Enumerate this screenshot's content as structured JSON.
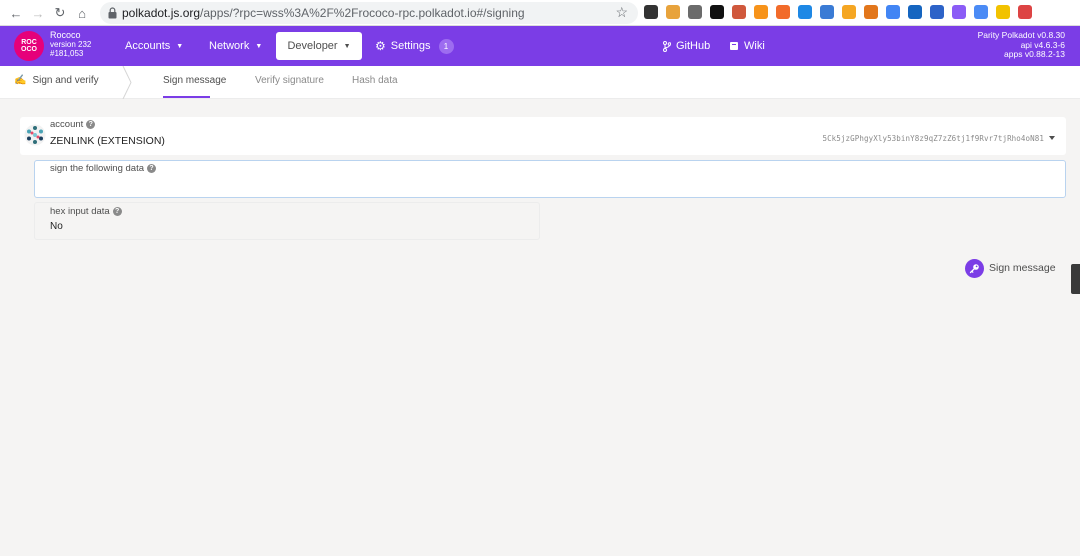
{
  "browser": {
    "url_host": "polkadot.js.org",
    "url_path": "/apps/?rpc=wss%3A%2F%2Frococo-rpc.polkadot.io#/signing",
    "extension_colors": [
      "#333333",
      "#e8a33c",
      "#6b6b6b",
      "#111111",
      "#d0583c",
      "#f7931a",
      "#f26b2a",
      "#1e88e5",
      "#3a7bd5",
      "#f5a623",
      "#e2761b",
      "#4285f4",
      "#1565c0",
      "#2d63c8",
      "#8b5cf6",
      "#4b8bf5",
      "#f2c200",
      "#d44"
    ]
  },
  "header": {
    "logo_text": "ROC OCO",
    "chain_name": "Rococo",
    "chain_version": "version 232",
    "block_number": "#181,053",
    "menu": {
      "accounts": "Accounts",
      "network": "Network",
      "developer": "Developer",
      "settings": "Settings",
      "settings_badge": "1",
      "github": "GitHub",
      "wiki": "Wiki"
    },
    "version_lines": [
      "Parity Polkadot v0.8.30",
      "api v4.6.3-6",
      "apps v0.88.2-13"
    ],
    "accent_color": "#7b3de6"
  },
  "tabs": {
    "section": "Sign and verify",
    "items": [
      "Sign message",
      "Verify signature",
      "Hash data"
    ],
    "active_index": 0
  },
  "form": {
    "account_label": "account",
    "account_name": "ZENLINK (EXTENSION)",
    "account_address": "5Ck5jzGPhgyXly53binY8z9qZ7zZ6tj1f9Rvr7tjRho4oN81",
    "data_label": "sign the following data",
    "data_value": "",
    "hex_label": "hex input data",
    "hex_value": "No",
    "sign_button": "Sign message"
  }
}
